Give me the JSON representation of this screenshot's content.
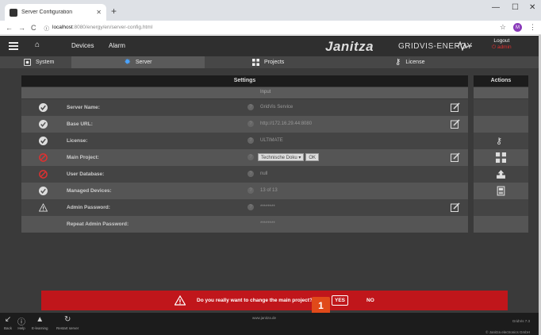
{
  "browser": {
    "tab_title": "Server Configuration",
    "url_host": "localhost",
    "url_path": ":8080/energy/en/server-config.html",
    "profile_initial": "M"
  },
  "header": {
    "nav": [
      "Devices",
      "Alarm"
    ],
    "brand": "Janitza",
    "brand_sub": "GRIDVIS-ENERGY",
    "logout_label": "Logout",
    "user": "admin"
  },
  "tabs": [
    {
      "label": "System",
      "icon": "system-icon"
    },
    {
      "label": "Server",
      "icon": "gear-icon"
    },
    {
      "label": "Projects",
      "icon": "projects-icon"
    },
    {
      "label": "License",
      "icon": "key-icon"
    }
  ],
  "table": {
    "settings_header": "Settings",
    "actions_header": "Actions",
    "input_header": "Input",
    "rows": [
      {
        "label": "Server Name:",
        "value": "GridVis Service",
        "status": "ok"
      },
      {
        "label": "Base URL:",
        "value": "http://172.16.29.44:8080",
        "status": "ok"
      },
      {
        "label": "License:",
        "value": "ULTIMATE",
        "status": "ok"
      },
      {
        "label": "Main Project:",
        "value": "Technische Doku ▾",
        "ok_label": "OK",
        "status": "error"
      },
      {
        "label": "User Database:",
        "value": "null",
        "status": "error"
      },
      {
        "label": "Managed Devices:",
        "value": "13 of 13",
        "status": "ok"
      },
      {
        "label": "Admin Password:",
        "value": "********",
        "status": "warning"
      },
      {
        "label": "Repeat Admin Password:",
        "value": "********",
        "status": "none"
      }
    ]
  },
  "alert": {
    "message": "Do you really want to change the main project?",
    "yes_label": "YES",
    "no_label": "NO",
    "step_badge": "1"
  },
  "footer": {
    "buttons": [
      "Back",
      "Help",
      "E-learning",
      "Restart server"
    ],
    "center": "www.janitza.de",
    "version": "GridVis 7.3",
    "copyright": "© Janitza electronics GmbH"
  },
  "colors": {
    "alert_red": "#c0161b",
    "error_red": "#e03030",
    "badge_orange": "#e04a1a"
  }
}
